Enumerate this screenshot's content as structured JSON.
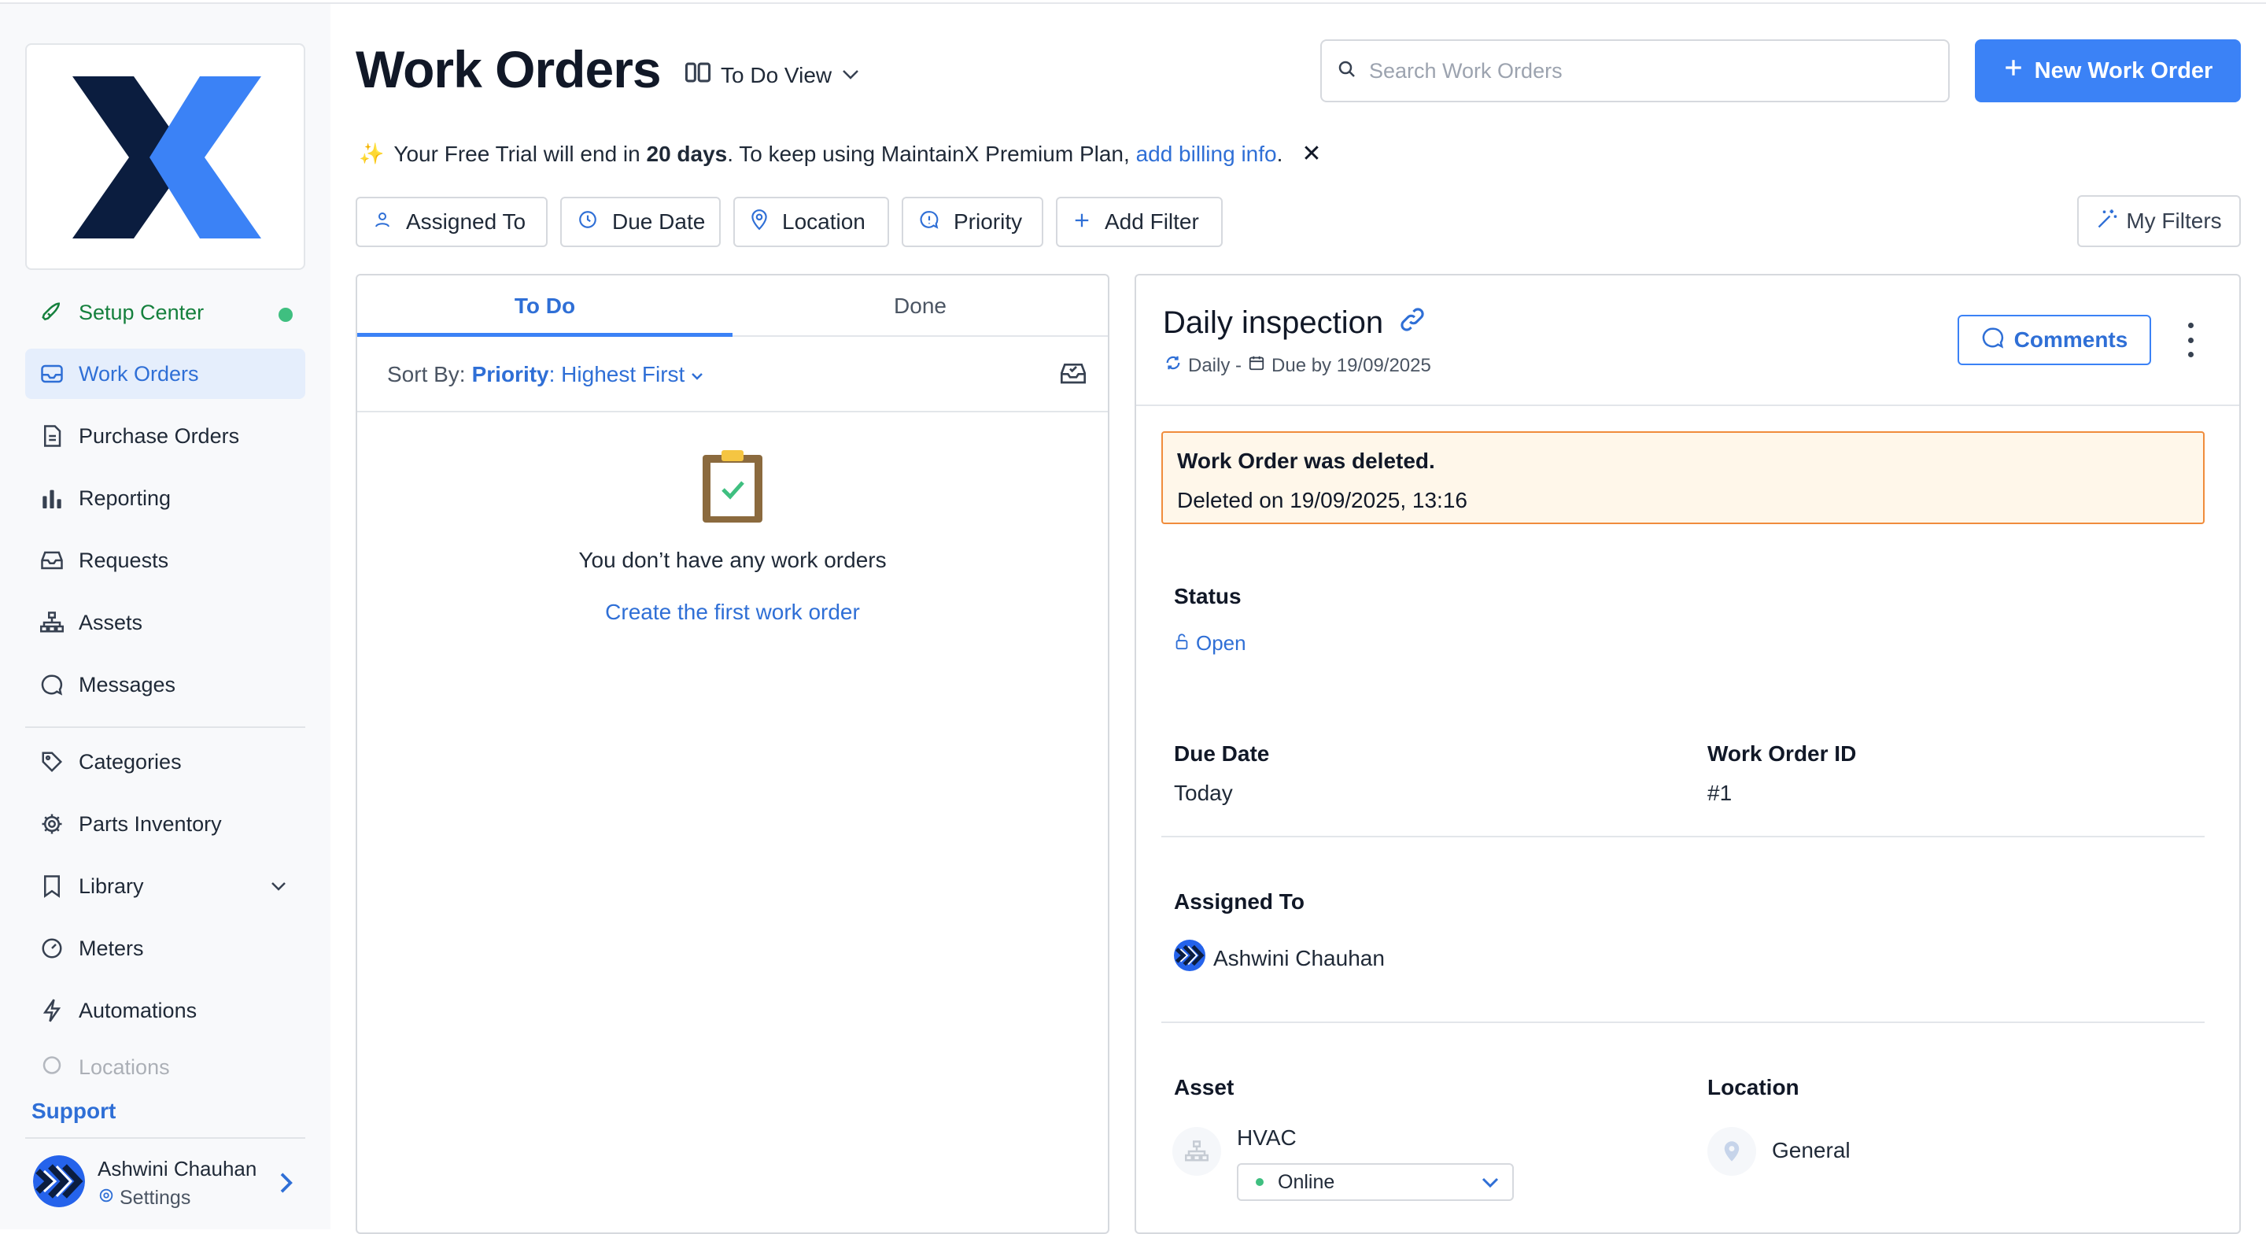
{
  "app": {
    "title": "Work Orders",
    "view_label": "To Do View"
  },
  "search": {
    "placeholder": "Search Work Orders"
  },
  "toolbar": {
    "new_work_order_label": "New Work Order",
    "my_filters_label": "My Filters"
  },
  "trial_banner": {
    "prefix": "Your Free Trial will end in",
    "days": "20 days",
    "middle": ". To keep using MaintainX Premium Plan,",
    "link": "add billing info",
    "suffix": "."
  },
  "filters": [
    {
      "label": "Assigned To",
      "icon": "person-icon"
    },
    {
      "label": "Due Date",
      "icon": "clock-icon"
    },
    {
      "label": "Location",
      "icon": "location-pin-icon"
    },
    {
      "label": "Priority",
      "icon": "priority-icon"
    },
    {
      "label": "Add Filter",
      "icon": "plus-icon"
    }
  ],
  "sidebar": {
    "items": [
      {
        "label": "Setup Center",
        "icon": "rocket-icon"
      },
      {
        "label": "Work Orders",
        "icon": "inbox-icon",
        "active": true
      },
      {
        "label": "Purchase Orders",
        "icon": "document-icon"
      },
      {
        "label": "Reporting",
        "icon": "bar-chart-icon"
      },
      {
        "label": "Requests",
        "icon": "tray-icon"
      },
      {
        "label": "Assets",
        "icon": "hierarchy-icon"
      },
      {
        "label": "Messages",
        "icon": "chat-icon"
      },
      {
        "label": "Categories",
        "icon": "tag-icon"
      },
      {
        "label": "Parts Inventory",
        "icon": "gear-icon"
      },
      {
        "label": "Library",
        "icon": "bookmark-icon"
      },
      {
        "label": "Meters",
        "icon": "gauge-icon"
      },
      {
        "label": "Automations",
        "icon": "bolt-icon"
      },
      {
        "label": "Locations",
        "icon": "location-pin-icon"
      }
    ],
    "support_label": "Support",
    "user": {
      "name": "Ashwini Chauhan",
      "settings_label": "Settings"
    }
  },
  "list": {
    "tabs": [
      "To Do",
      "Done"
    ],
    "sort_prefix": "Sort By:",
    "sort_field": "Priority",
    "sort_order": ": Highest First",
    "empty_text": "You don’t have any work orders",
    "empty_link": "Create the first work order"
  },
  "detail": {
    "title": "Daily inspection",
    "recurrence": "Daily -",
    "due": "Due by 19/09/2025",
    "comments_label": "Comments",
    "alert_title": "Work Order was deleted.",
    "alert_text": "Deleted on 19/09/2025, 13:16",
    "status_label": "Status",
    "status_value": "Open",
    "due_date_label": "Due Date",
    "due_date_value": "Today",
    "wo_id_label": "Work Order ID",
    "wo_id_value": "#1",
    "assigned_label": "Assigned To",
    "assigned_value": "Ashwini Chauhan",
    "asset_label": "Asset",
    "asset_value": "HVAC",
    "asset_status": "Online",
    "location_label": "Location",
    "location_value": "General"
  },
  "colors": {
    "accent": "#3b82f6",
    "link": "#2f6fd6",
    "alert_border": "#f08c3c",
    "alert_bg": "#fff7ea",
    "online": "#3fbf80"
  }
}
